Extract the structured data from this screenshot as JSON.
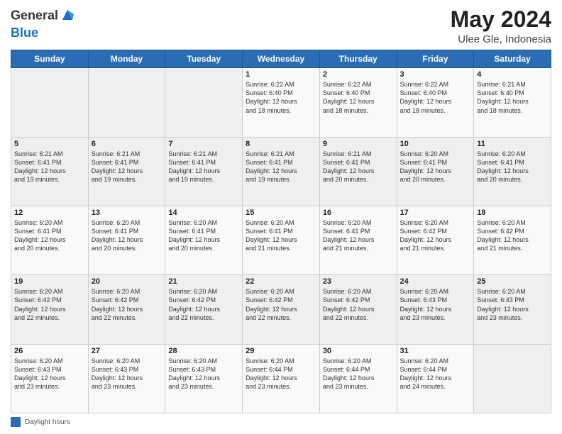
{
  "header": {
    "logo_general": "General",
    "logo_blue": "Blue",
    "month_year": "May 2024",
    "location": "Ulee Gle, Indonesia"
  },
  "days_of_week": [
    "Sunday",
    "Monday",
    "Tuesday",
    "Wednesday",
    "Thursday",
    "Friday",
    "Saturday"
  ],
  "weeks": [
    [
      {
        "day": "",
        "info": ""
      },
      {
        "day": "",
        "info": ""
      },
      {
        "day": "",
        "info": ""
      },
      {
        "day": "1",
        "info": "Sunrise: 6:22 AM\nSunset: 6:40 PM\nDaylight: 12 hours\nand 18 minutes."
      },
      {
        "day": "2",
        "info": "Sunrise: 6:22 AM\nSunset: 6:40 PM\nDaylight: 12 hours\nand 18 minutes."
      },
      {
        "day": "3",
        "info": "Sunrise: 6:22 AM\nSunset: 6:40 PM\nDaylight: 12 hours\nand 18 minutes."
      },
      {
        "day": "4",
        "info": "Sunrise: 6:21 AM\nSunset: 6:40 PM\nDaylight: 12 hours\nand 18 minutes."
      }
    ],
    [
      {
        "day": "5",
        "info": "Sunrise: 6:21 AM\nSunset: 6:41 PM\nDaylight: 12 hours\nand 19 minutes."
      },
      {
        "day": "6",
        "info": "Sunrise: 6:21 AM\nSunset: 6:41 PM\nDaylight: 12 hours\nand 19 minutes."
      },
      {
        "day": "7",
        "info": "Sunrise: 6:21 AM\nSunset: 6:41 PM\nDaylight: 12 hours\nand 19 minutes."
      },
      {
        "day": "8",
        "info": "Sunrise: 6:21 AM\nSunset: 6:41 PM\nDaylight: 12 hours\nand 19 minutes."
      },
      {
        "day": "9",
        "info": "Sunrise: 6:21 AM\nSunset: 6:41 PM\nDaylight: 12 hours\nand 20 minutes."
      },
      {
        "day": "10",
        "info": "Sunrise: 6:20 AM\nSunset: 6:41 PM\nDaylight: 12 hours\nand 20 minutes."
      },
      {
        "day": "11",
        "info": "Sunrise: 6:20 AM\nSunset: 6:41 PM\nDaylight: 12 hours\nand 20 minutes."
      }
    ],
    [
      {
        "day": "12",
        "info": "Sunrise: 6:20 AM\nSunset: 6:41 PM\nDaylight: 12 hours\nand 20 minutes."
      },
      {
        "day": "13",
        "info": "Sunrise: 6:20 AM\nSunset: 6:41 PM\nDaylight: 12 hours\nand 20 minutes."
      },
      {
        "day": "14",
        "info": "Sunrise: 6:20 AM\nSunset: 6:41 PM\nDaylight: 12 hours\nand 20 minutes."
      },
      {
        "day": "15",
        "info": "Sunrise: 6:20 AM\nSunset: 6:41 PM\nDaylight: 12 hours\nand 21 minutes."
      },
      {
        "day": "16",
        "info": "Sunrise: 6:20 AM\nSunset: 6:41 PM\nDaylight: 12 hours\nand 21 minutes."
      },
      {
        "day": "17",
        "info": "Sunrise: 6:20 AM\nSunset: 6:42 PM\nDaylight: 12 hours\nand 21 minutes."
      },
      {
        "day": "18",
        "info": "Sunrise: 6:20 AM\nSunset: 6:42 PM\nDaylight: 12 hours\nand 21 minutes."
      }
    ],
    [
      {
        "day": "19",
        "info": "Sunrise: 6:20 AM\nSunset: 6:42 PM\nDaylight: 12 hours\nand 22 minutes."
      },
      {
        "day": "20",
        "info": "Sunrise: 6:20 AM\nSunset: 6:42 PM\nDaylight: 12 hours\nand 22 minutes."
      },
      {
        "day": "21",
        "info": "Sunrise: 6:20 AM\nSunset: 6:42 PM\nDaylight: 12 hours\nand 22 minutes."
      },
      {
        "day": "22",
        "info": "Sunrise: 6:20 AM\nSunset: 6:42 PM\nDaylight: 12 hours\nand 22 minutes."
      },
      {
        "day": "23",
        "info": "Sunrise: 6:20 AM\nSunset: 6:42 PM\nDaylight: 12 hours\nand 22 minutes."
      },
      {
        "day": "24",
        "info": "Sunrise: 6:20 AM\nSunset: 6:43 PM\nDaylight: 12 hours\nand 23 minutes."
      },
      {
        "day": "25",
        "info": "Sunrise: 6:20 AM\nSunset: 6:43 PM\nDaylight: 12 hours\nand 23 minutes."
      }
    ],
    [
      {
        "day": "26",
        "info": "Sunrise: 6:20 AM\nSunset: 6:43 PM\nDaylight: 12 hours\nand 23 minutes."
      },
      {
        "day": "27",
        "info": "Sunrise: 6:20 AM\nSunset: 6:43 PM\nDaylight: 12 hours\nand 23 minutes."
      },
      {
        "day": "28",
        "info": "Sunrise: 6:20 AM\nSunset: 6:43 PM\nDaylight: 12 hours\nand 23 minutes."
      },
      {
        "day": "29",
        "info": "Sunrise: 6:20 AM\nSunset: 6:44 PM\nDaylight: 12 hours\nand 23 minutes."
      },
      {
        "day": "30",
        "info": "Sunrise: 6:20 AM\nSunset: 6:44 PM\nDaylight: 12 hours\nand 23 minutes."
      },
      {
        "day": "31",
        "info": "Sunrise: 6:20 AM\nSunset: 6:44 PM\nDaylight: 12 hours\nand 24 minutes."
      },
      {
        "day": "",
        "info": ""
      }
    ]
  ],
  "footer": {
    "label": "Daylight hours"
  }
}
